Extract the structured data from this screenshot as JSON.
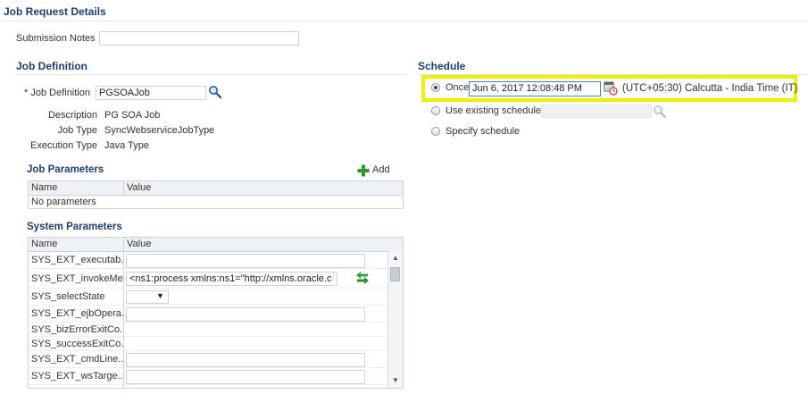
{
  "page_title": "Job Request Details",
  "submission_notes": {
    "label": "Submission Notes",
    "value": ""
  },
  "job_definition": {
    "heading": "Job Definition",
    "field_label": "* Job Definition",
    "field_value": "PGSOAJob",
    "search_icon": "magnifier-icon",
    "details": [
      {
        "label": "Description",
        "value": "PG SOA Job"
      },
      {
        "label": "Job Type",
        "value": "SyncWebserviceJobType"
      },
      {
        "label": "Execution Type",
        "value": "Java Type"
      }
    ]
  },
  "job_parameters": {
    "heading": "Job Parameters",
    "add_label": "Add",
    "columns": [
      "Name",
      "Value"
    ],
    "empty_text": "No parameters"
  },
  "system_parameters": {
    "heading": "System Parameters",
    "columns": [
      "Name",
      "Value"
    ],
    "rows": [
      {
        "name": "SYS_EXT_executab...",
        "value": "",
        "kind": "input"
      },
      {
        "name": "SYS_EXT_invokeMe...",
        "value": "<ns1:process xmlns:ns1=\"http://xmlns.oracle.c",
        "kind": "input-action"
      },
      {
        "name": "SYS_selectState",
        "value": "",
        "kind": "select"
      },
      {
        "name": "SYS_EXT_ejbOpera...",
        "value": "",
        "kind": "input"
      },
      {
        "name": "SYS_bizErrorExitCo...",
        "value": "",
        "kind": "none"
      },
      {
        "name": "SYS_successExitCo...",
        "value": "",
        "kind": "none"
      },
      {
        "name": "SYS_EXT_cmdLine...",
        "value": "",
        "kind": "input"
      },
      {
        "name": "SYS_EXT_wsTarge...",
        "value": "",
        "kind": "input"
      }
    ]
  },
  "schedule": {
    "heading": "Schedule",
    "options": [
      {
        "label": "Once",
        "selected": true
      },
      {
        "label": "Use existing schedule",
        "selected": false
      },
      {
        "label": "Specify schedule",
        "selected": false
      }
    ],
    "once_datetime": "Jun 6, 2017 12:08:48 PM",
    "timezone": "(UTC+05:30) Calcutta - India Time (IT)",
    "highlight_color": "#f3ee00"
  },
  "colors": {
    "heading": "#1f3f6b",
    "border": "#c9d3de",
    "add_icon": "#2e9a2e",
    "action_icon": "#3aa33a"
  }
}
